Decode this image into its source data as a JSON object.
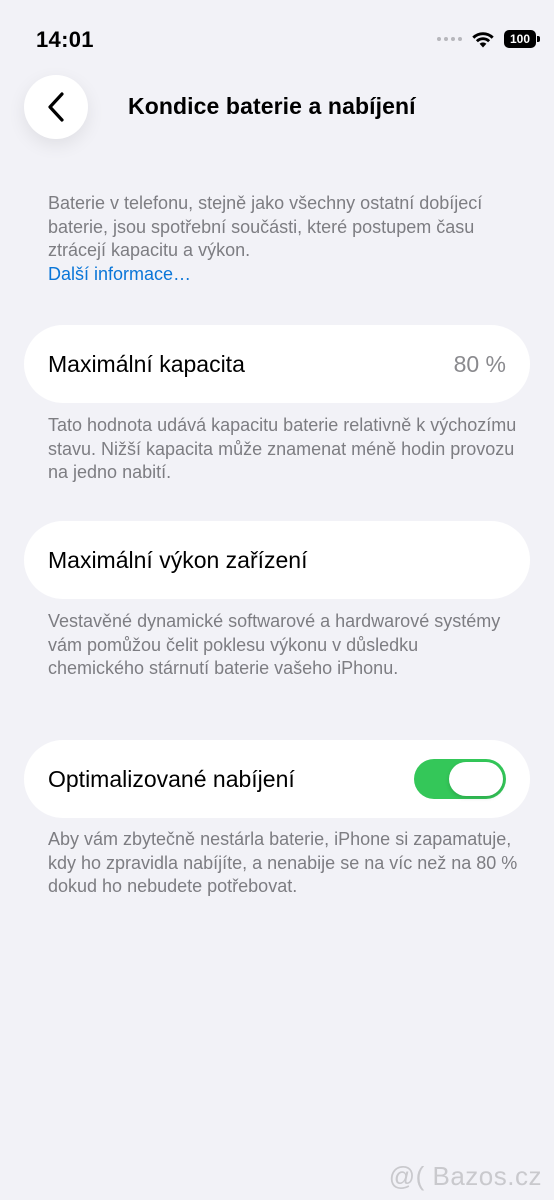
{
  "status_bar": {
    "time": "14:01",
    "battery_level": "100",
    "wifi_icon": "wifi-icon",
    "signal_icon": "signal-dots-icon"
  },
  "nav": {
    "back_icon": "chevron-left-icon",
    "title": "Kondice baterie a nabíjení"
  },
  "intro": {
    "text": "Baterie v telefonu, stejně jako všechny ostatní dobíjecí baterie, jsou spotřební součásti, které postupem času ztrácejí kapacitu a výkon.",
    "link": "Další informace…"
  },
  "capacity": {
    "label": "Maximální kapacita",
    "value": "80 %",
    "note": "Tato hodnota udává kapacitu baterie relativně k výchozímu stavu. Nižší kapacita může znamenat méně hodin provozu na jedno nabití."
  },
  "performance": {
    "label": "Maximální výkon zařízení",
    "note": "Vestavěné dynamické softwarové a hardwarové systémy vám pomůžou čelit poklesu výkonu v důsledku chemického stárnutí baterie vašeho iPhonu."
  },
  "optimized_charging": {
    "label": "Optimalizované nabíjení",
    "enabled": true,
    "note": "Aby vám zbytečně nestárla baterie, iPhone si zapamatuje, kdy ho zpravidla nabíjíte, a nenabije se na víc než na 80 % dokud ho nebudete potřebovat."
  },
  "watermark": "@( Bazos.cz",
  "colors": {
    "background": "#f2f2f7",
    "link": "#0a76d8",
    "toggle_on": "#34c759",
    "secondary_text": "#7d7d82"
  }
}
